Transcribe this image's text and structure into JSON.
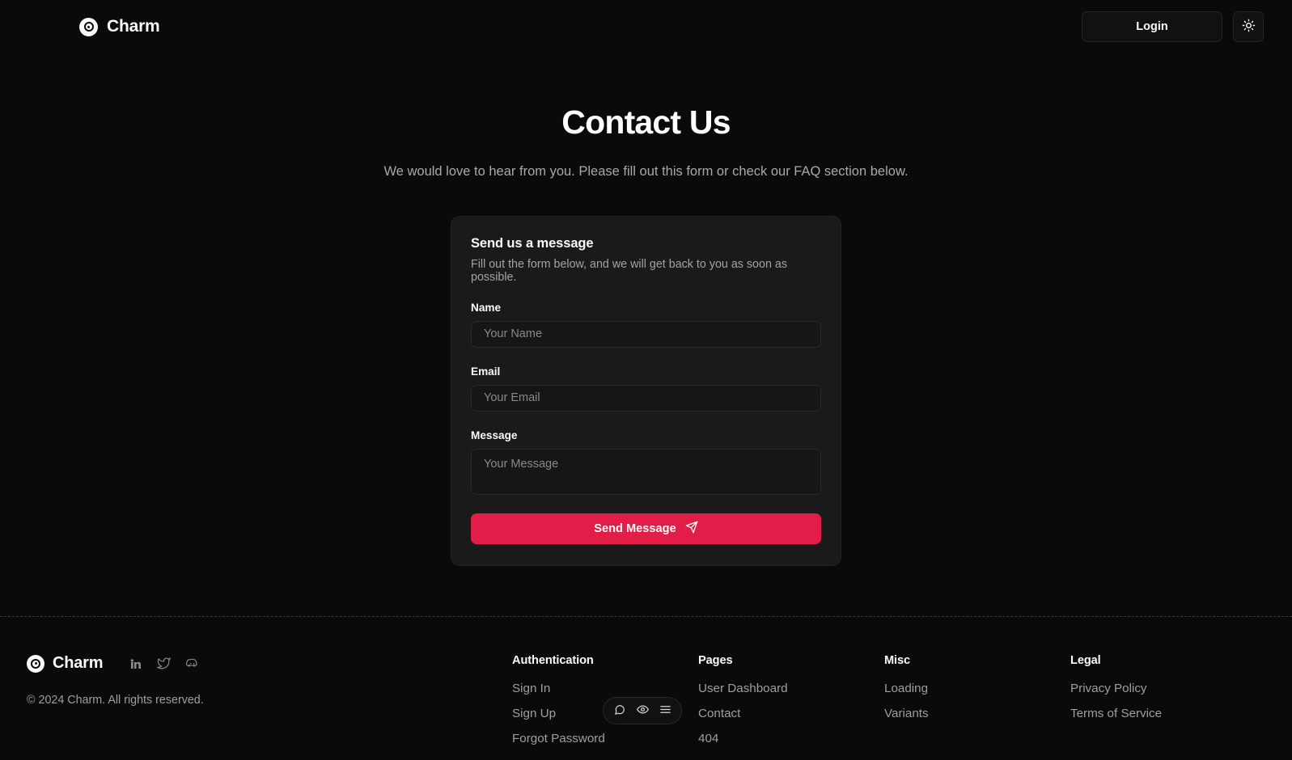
{
  "header": {
    "brand": "Charm",
    "brand_icon": "bullseye-icon",
    "login_label": "Login",
    "theme_icon": "sun-icon"
  },
  "hero": {
    "title": "Contact Us",
    "subtitle": "We would love to hear from you. Please fill out this form or check our FAQ section below."
  },
  "contact_form": {
    "title": "Send us a message",
    "description": "Fill out the form below, and we will get back to you as soon as possible.",
    "fields": [
      {
        "label": "Name",
        "placeholder": "Your Name",
        "value": ""
      },
      {
        "label": "Email",
        "placeholder": "Your Email",
        "value": ""
      },
      {
        "label": "Message",
        "placeholder": "Your Message",
        "value": ""
      }
    ],
    "submit_label": "Send Message",
    "submit_icon": "send-icon",
    "submit_color": "#e11d48"
  },
  "footer": {
    "brand": "Charm",
    "brand_icon": "bullseye-icon",
    "copyright": "© 2024 Charm. All rights reserved.",
    "socials": [
      {
        "name": "linkedin-icon",
        "label": "LinkedIn"
      },
      {
        "name": "twitter-icon",
        "label": "Twitter"
      },
      {
        "name": "discord-icon",
        "label": "Discord"
      }
    ],
    "columns": [
      {
        "heading": "Authentication",
        "links": [
          "Sign In",
          "Sign Up",
          "Forgot Password"
        ]
      },
      {
        "heading": "Pages",
        "links": [
          "User Dashboard",
          "Contact",
          "404"
        ]
      },
      {
        "heading": "Misc",
        "links": [
          "Loading",
          "Variants"
        ]
      },
      {
        "heading": "Legal",
        "links": [
          "Privacy Policy",
          "Terms of Service"
        ]
      }
    ]
  },
  "float_widget": {
    "buttons": [
      {
        "name": "chat-bubble-icon",
        "label": "Chat"
      },
      {
        "name": "eye-icon",
        "label": "Preview"
      },
      {
        "name": "hamburger-menu-icon",
        "label": "Menu"
      }
    ]
  },
  "colors": {
    "background": "#0a0a0a",
    "card": "#1b1a1a",
    "accent": "#e11d48",
    "text": "#fafafa",
    "muted": "#a09e9e"
  }
}
